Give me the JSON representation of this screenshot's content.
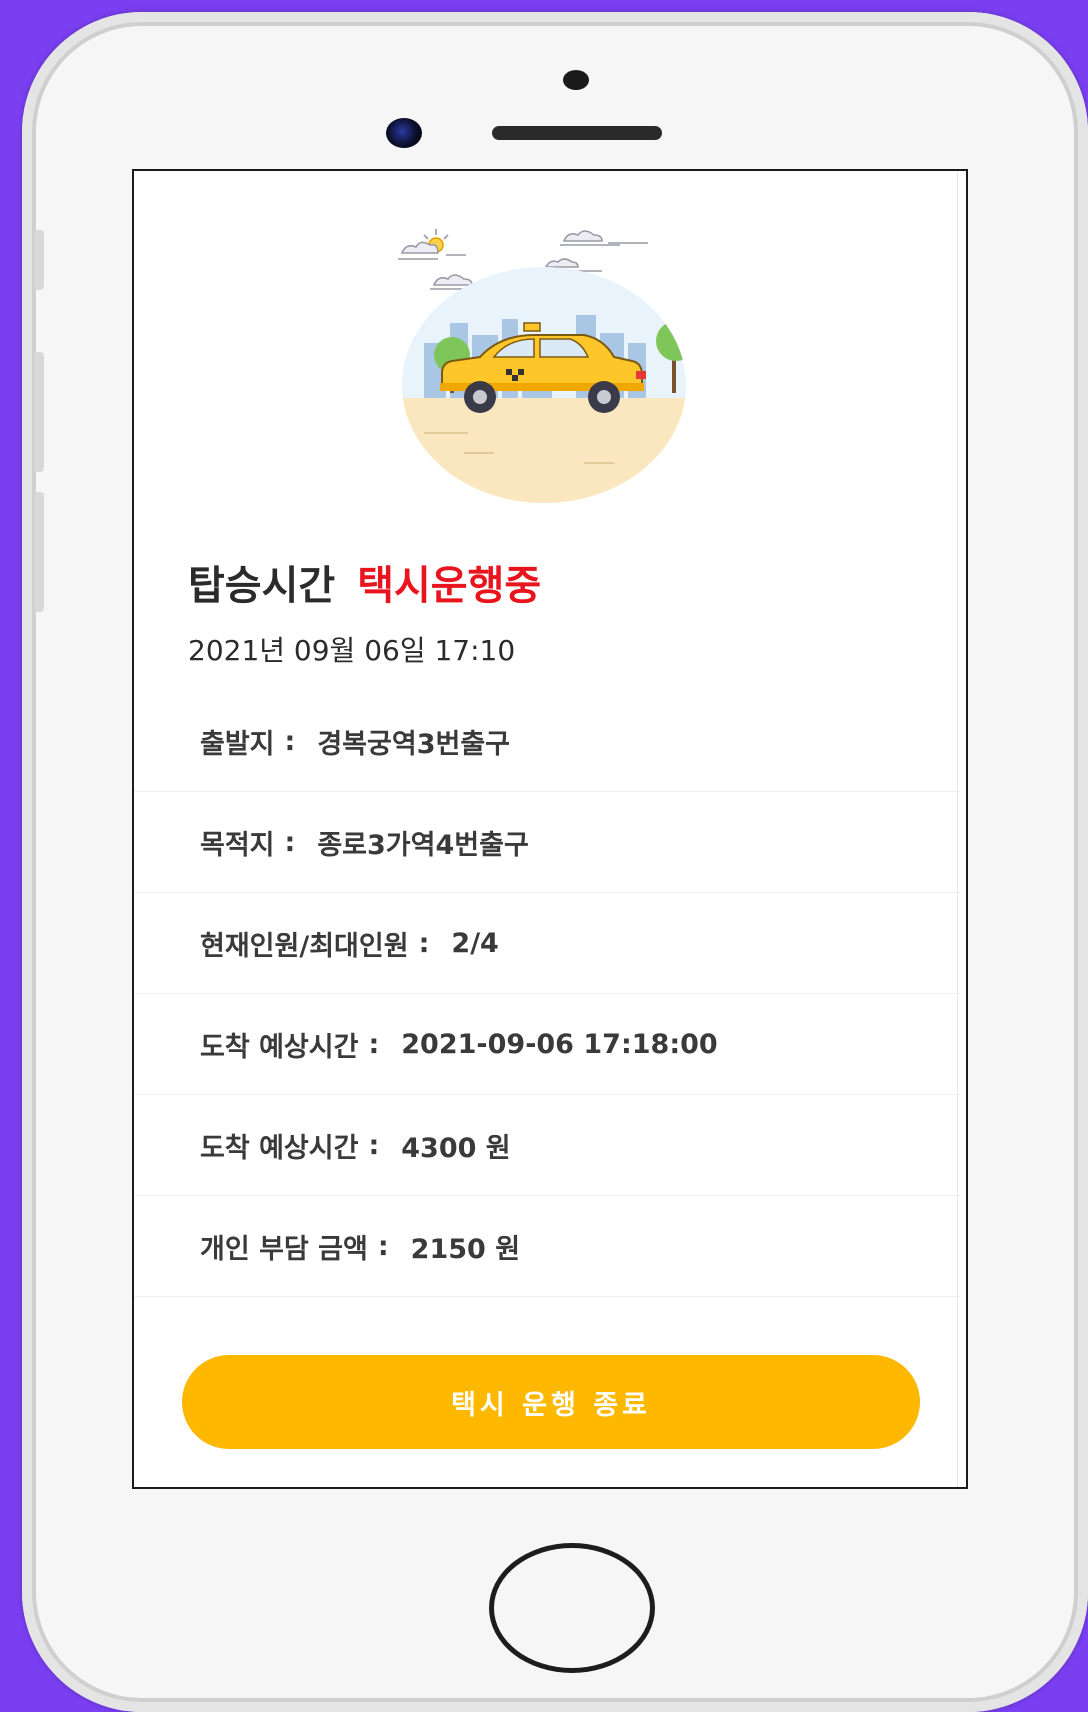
{
  "header": {
    "title": "탑승시간",
    "status": "택시운행중",
    "datetime": "2021년 09월 06일 17:10"
  },
  "info": [
    {
      "label": "출발지",
      "value": "경복궁역3번출구"
    },
    {
      "label": "목적지",
      "value": "종로3가역4번출구"
    },
    {
      "label": "현재인원/최대인원",
      "value": "2/4"
    },
    {
      "label": "도착 예상시간",
      "value": "2021-09-06 17:18:00"
    },
    {
      "label": "도착 예상시간",
      "value": "4300 원"
    },
    {
      "label": "개인 부담 금액",
      "value": "2150 원"
    }
  ],
  "separator": ":",
  "actions": {
    "end_ride_label": "택시 운행 종료"
  },
  "colors": {
    "accent": "#ffb800",
    "status": "#e8141e",
    "background": "#7b3ff2"
  },
  "illustration": {
    "icon": "taxi-city-illustration"
  }
}
